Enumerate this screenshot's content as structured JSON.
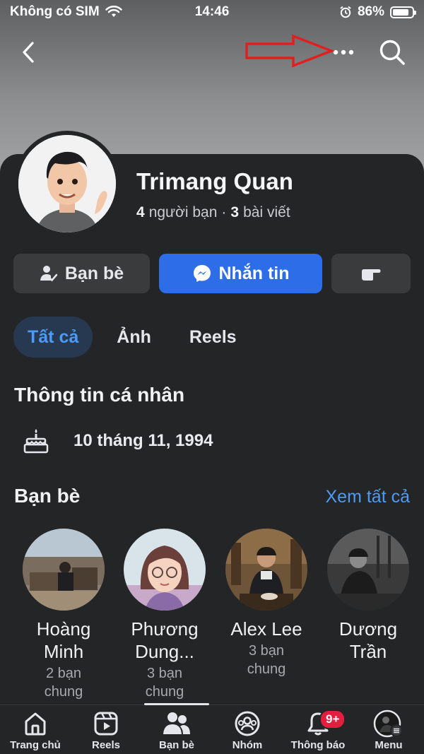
{
  "status_bar": {
    "carrier": "Không có SIM",
    "time": "14:46",
    "battery": "86%",
    "battery_level": 0.86
  },
  "profile": {
    "name": "Trimang Quan",
    "friends_count": "4",
    "friends_label": "người bạn",
    "separator": "·",
    "posts_count": "3",
    "posts_label": "bài viết"
  },
  "actions": {
    "friends": "Bạn bè",
    "message": "Nhắn tin"
  },
  "tabs": [
    {
      "label": "Tất cả",
      "active": true
    },
    {
      "label": "Ảnh"
    },
    {
      "label": "Reels"
    }
  ],
  "info": {
    "title": "Thông tin cá nhân",
    "birthday": "10 tháng 11, 1994"
  },
  "friends_section": {
    "title": "Bạn bè",
    "see_all": "Xem tất cả"
  },
  "friends": [
    {
      "name_line1": "Hoàng",
      "name_line2": "Minh",
      "mutual_line1": "2 bạn",
      "mutual_line2": "chung"
    },
    {
      "name_line1": "Phương",
      "name_line2": "Dung...",
      "mutual_line1": "3 bạn",
      "mutual_line2": "chung"
    },
    {
      "name_line1": "Alex Lee",
      "name_line2": "",
      "mutual_line1": "3 bạn",
      "mutual_line2": "chung"
    },
    {
      "name_line1": "Dương",
      "name_line2": "Trần",
      "mutual_line1": "",
      "mutual_line2": ""
    }
  ],
  "bottom_nav": [
    {
      "label": "Trang chủ",
      "icon": "home-icon"
    },
    {
      "label": "Reels",
      "icon": "reels-icon"
    },
    {
      "label": "Bạn bè",
      "icon": "friends-icon",
      "active": true
    },
    {
      "label": "Nhóm",
      "icon": "groups-icon"
    },
    {
      "label": "Thông báo",
      "icon": "bell-icon",
      "badge": "9+"
    },
    {
      "label": "Menu",
      "icon": "menu-avatar-icon"
    }
  ],
  "colors": {
    "accent": "#2d6ee8",
    "link": "#4d9bf4",
    "badge": "#e41e3f",
    "annotation_arrow": "#e02020"
  }
}
